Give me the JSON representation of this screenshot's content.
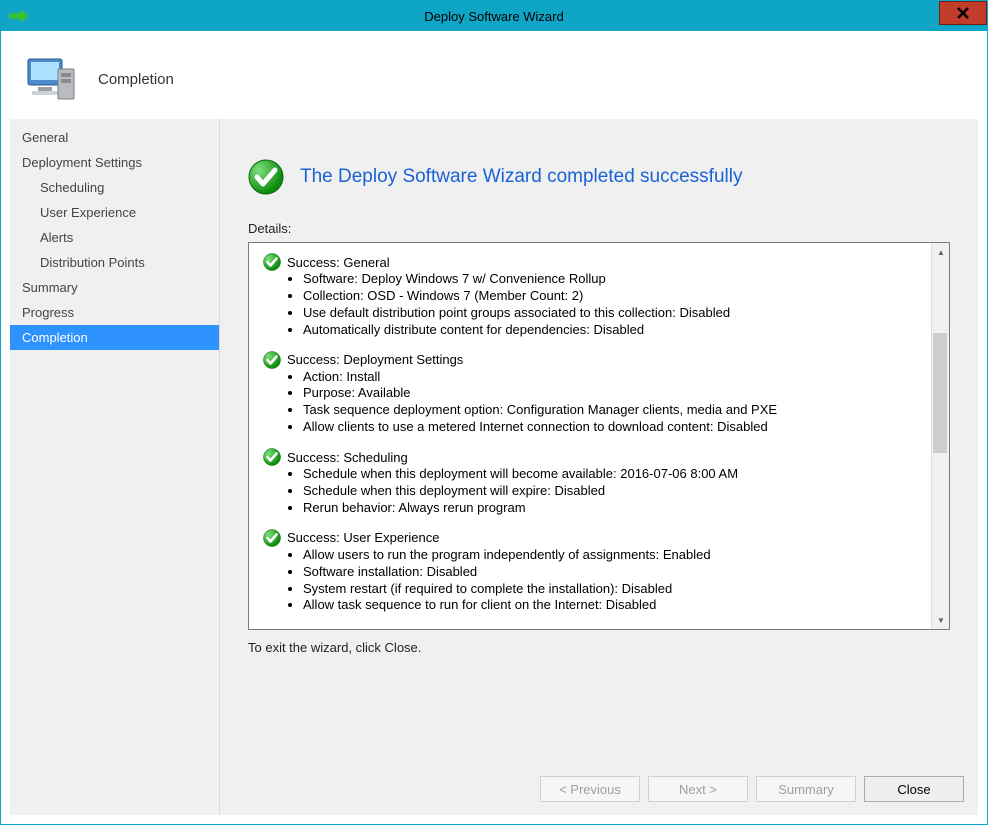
{
  "titlebar": {
    "title": "Deploy Software Wizard"
  },
  "header": {
    "title": "Completion"
  },
  "sidebar": {
    "items": [
      {
        "label": "General",
        "sub": false,
        "selected": false
      },
      {
        "label": "Deployment Settings",
        "sub": false,
        "selected": false
      },
      {
        "label": "Scheduling",
        "sub": true,
        "selected": false
      },
      {
        "label": "User Experience",
        "sub": true,
        "selected": false
      },
      {
        "label": "Alerts",
        "sub": true,
        "selected": false
      },
      {
        "label": "Distribution Points",
        "sub": true,
        "selected": false
      },
      {
        "label": "Summary",
        "sub": false,
        "selected": false
      },
      {
        "label": "Progress",
        "sub": false,
        "selected": false
      },
      {
        "label": "Completion",
        "sub": false,
        "selected": true
      }
    ]
  },
  "main": {
    "banner": "The Deploy Software Wizard completed successfully",
    "details_label": "Details:",
    "exit_text": "To exit the wizard, click Close.",
    "sections": [
      {
        "title": "Success: General",
        "bullets": [
          "Software: Deploy Windows 7 w/ Convenience Rollup",
          "Collection: OSD - Windows 7 (Member Count: 2)",
          "Use default distribution point groups associated to this collection: Disabled",
          "Automatically distribute content for dependencies: Disabled"
        ]
      },
      {
        "title": "Success: Deployment Settings",
        "bullets": [
          "Action: Install",
          "Purpose: Available",
          "Task sequence deployment option: Configuration Manager clients, media and PXE",
          "Allow clients to use a metered Internet connection to download content: Disabled"
        ]
      },
      {
        "title": "Success: Scheduling",
        "bullets": [
          "Schedule when this deployment will become available: 2016-07-06 8:00 AM",
          "Schedule when this deployment will expire: Disabled",
          "Rerun behavior: Always rerun program"
        ]
      },
      {
        "title": "Success: User Experience",
        "bullets": [
          "Allow users to run the program independently of assignments: Enabled",
          "Software installation: Disabled",
          "System restart (if required to complete the installation): Disabled",
          "Allow task sequence to run for client on the Internet: Disabled"
        ]
      }
    ]
  },
  "footer": {
    "previous": "< Previous",
    "next": "Next >",
    "summary": "Summary",
    "close": "Close"
  }
}
